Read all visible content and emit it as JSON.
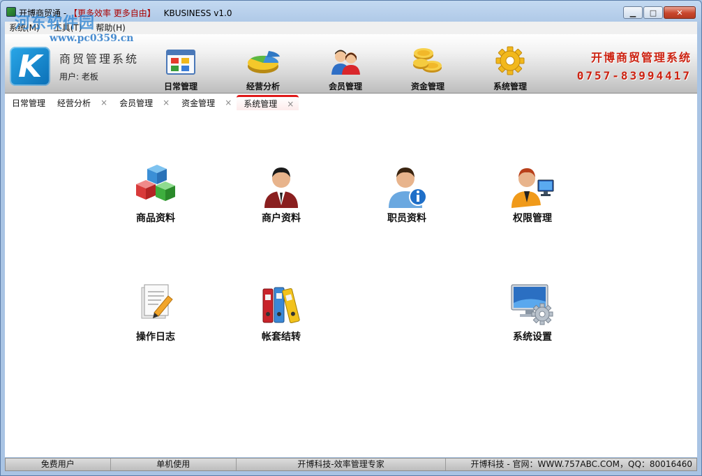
{
  "window": {
    "title_prefix": "开博商贸通 -",
    "title_slogan": "【更多效率 更多自由】",
    "title_suffix": "KBUSINESS v1.0",
    "buttons": {
      "minimize": "▁",
      "maximize": "□",
      "close": "✕"
    }
  },
  "watermark": {
    "text": "河东软件园",
    "url": "www.pc0359.cn"
  },
  "menu": [
    {
      "label": "系统(M)"
    },
    {
      "label": "工具(T)"
    },
    {
      "label": "帮助(H)"
    }
  ],
  "header": {
    "logo_letter": "K",
    "system_name": "商贸管理系统",
    "user_label": "用户: 老板",
    "nav": [
      {
        "label": "日常管理",
        "icon": "daily-icon"
      },
      {
        "label": "经营分析",
        "icon": "pie-chart-icon"
      },
      {
        "label": "会员管理",
        "icon": "members-icon"
      },
      {
        "label": "资金管理",
        "icon": "coins-icon"
      },
      {
        "label": "系统管理",
        "icon": "gear-icon"
      }
    ],
    "brand_name": "开博商贸管理系统",
    "brand_phone": "0757-83994417"
  },
  "tabs": [
    {
      "label": "日常管理",
      "closable": false
    },
    {
      "label": "经营分析",
      "closable": true
    },
    {
      "label": "会员管理",
      "closable": true
    },
    {
      "label": "资金管理",
      "closable": true
    },
    {
      "label": "系统管理",
      "closable": true,
      "active": true
    }
  ],
  "tab_close_glyph": "×",
  "tiles": [
    {
      "label": "商品资料",
      "icon": "cubes-icon"
    },
    {
      "label": "商户资料",
      "icon": "businessman-icon"
    },
    {
      "label": "职员资料",
      "icon": "employee-info-icon"
    },
    {
      "label": "权限管理",
      "icon": "user-computer-icon"
    },
    {
      "label": "操作日志",
      "icon": "log-edit-icon"
    },
    {
      "label": "帐套结转",
      "icon": "binders-icon"
    },
    {
      "label": "系统设置",
      "icon": "monitor-gear-icon"
    }
  ],
  "status": {
    "user_type": "免费用户",
    "mode": "单机使用",
    "slogan": "开博科技-效率管理专家",
    "contact": "开博科技 - 官网：WWW.757ABC.COM，QQ：80016460"
  },
  "colors": {
    "accent_red": "#e01919",
    "brand_red": "#cc2211",
    "logo_blue": "#1a8ad4"
  }
}
